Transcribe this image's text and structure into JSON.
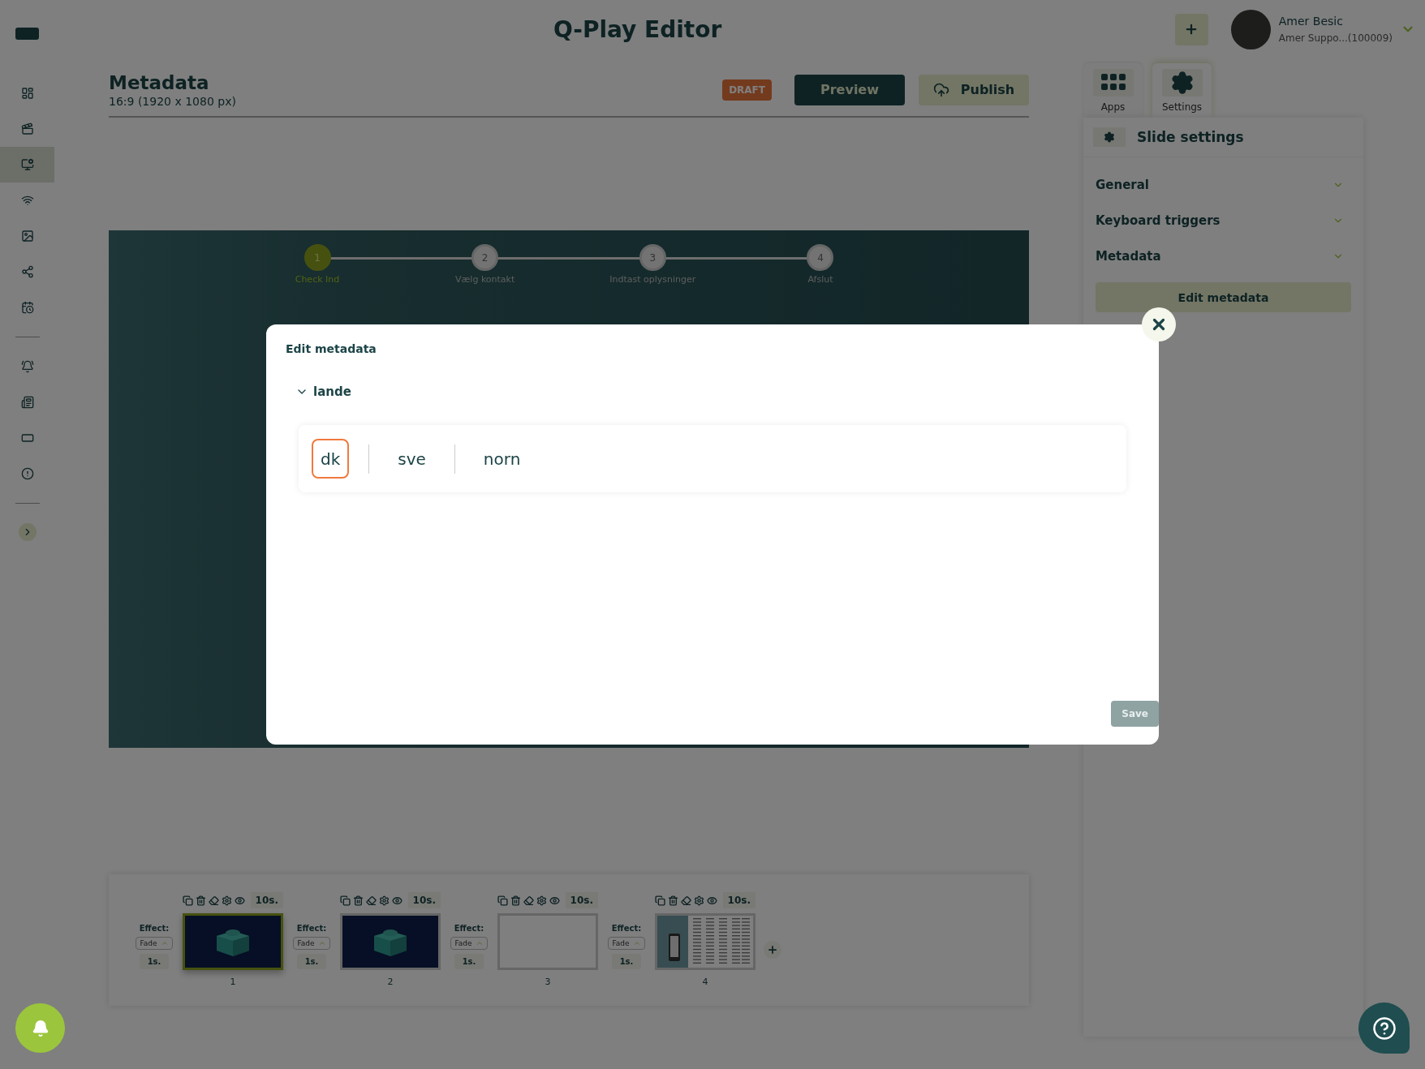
{
  "app_title": "Q-Play Editor",
  "sidebar": {
    "groups": [
      [
        {
          "selected": false
        },
        {
          "selected": false
        },
        {
          "selected": true
        },
        {
          "selected": false
        },
        {
          "selected": false
        },
        {
          "selected": false
        },
        {
          "selected": false
        }
      ],
      [
        {
          "selected": false
        },
        {
          "selected": false
        },
        {
          "selected": false
        },
        {
          "selected": false
        }
      ]
    ]
  },
  "user": {
    "name": "Amer Besic",
    "account": "Amer Suppo...(100009)"
  },
  "header": {
    "title": "Metadata",
    "subtitle": "16:9 (1920 x 1080 px)",
    "status": "DRAFT",
    "buttons": [
      {
        "label": "Preview",
        "kind": "primary"
      },
      {
        "label": "Publish",
        "kind": "publish"
      }
    ]
  },
  "panel": {
    "tabs": [
      {
        "label": "Apps",
        "kind": "apps",
        "selected": false
      },
      {
        "label": "Settings",
        "kind": "settings",
        "selected": true
      }
    ],
    "title": "Slide settings",
    "sections": [
      {
        "label": "General"
      },
      {
        "label": "Keyboard triggers"
      },
      {
        "label": "Metadata"
      }
    ],
    "action": "Edit metadata"
  },
  "slide": {
    "steps": [
      {
        "number": "1",
        "label": "Check Ind",
        "active": true
      },
      {
        "number": "2",
        "label": "Vælg kontakt",
        "active": false
      },
      {
        "number": "3",
        "label": "Indtast oplysninger",
        "active": false
      },
      {
        "number": "4",
        "label": "Afslut",
        "active": false
      }
    ]
  },
  "timeline": {
    "slides": [
      {
        "number": "1",
        "duration": "10s.",
        "effect_label": "Effect:",
        "effect": "Fade",
        "effect_duration": "1s.",
        "kind": "cube",
        "selected": true
      },
      {
        "number": "2",
        "duration": "10s.",
        "effect_label": "Effect:",
        "effect": "Fade",
        "effect_duration": "1s.",
        "kind": "cube",
        "selected": false
      },
      {
        "number": "3",
        "duration": "10s.",
        "effect_label": "Effect:",
        "effect": "Fade",
        "effect_duration": "1s.",
        "kind": "blank",
        "selected": false
      },
      {
        "number": "4",
        "duration": "10s.",
        "effect_label": "Effect:",
        "effect": "Fade",
        "effect_duration": "1s.",
        "kind": "document",
        "selected": false
      }
    ]
  },
  "modal": {
    "title": "Edit metadata",
    "group": {
      "label": "lande",
      "expanded": true,
      "tags": [
        {
          "label": "dk",
          "selected": true
        },
        {
          "label": "sve",
          "selected": false
        },
        {
          "label": "norn",
          "selected": false
        }
      ]
    },
    "save": {
      "label": "Save",
      "disabled": true
    }
  }
}
